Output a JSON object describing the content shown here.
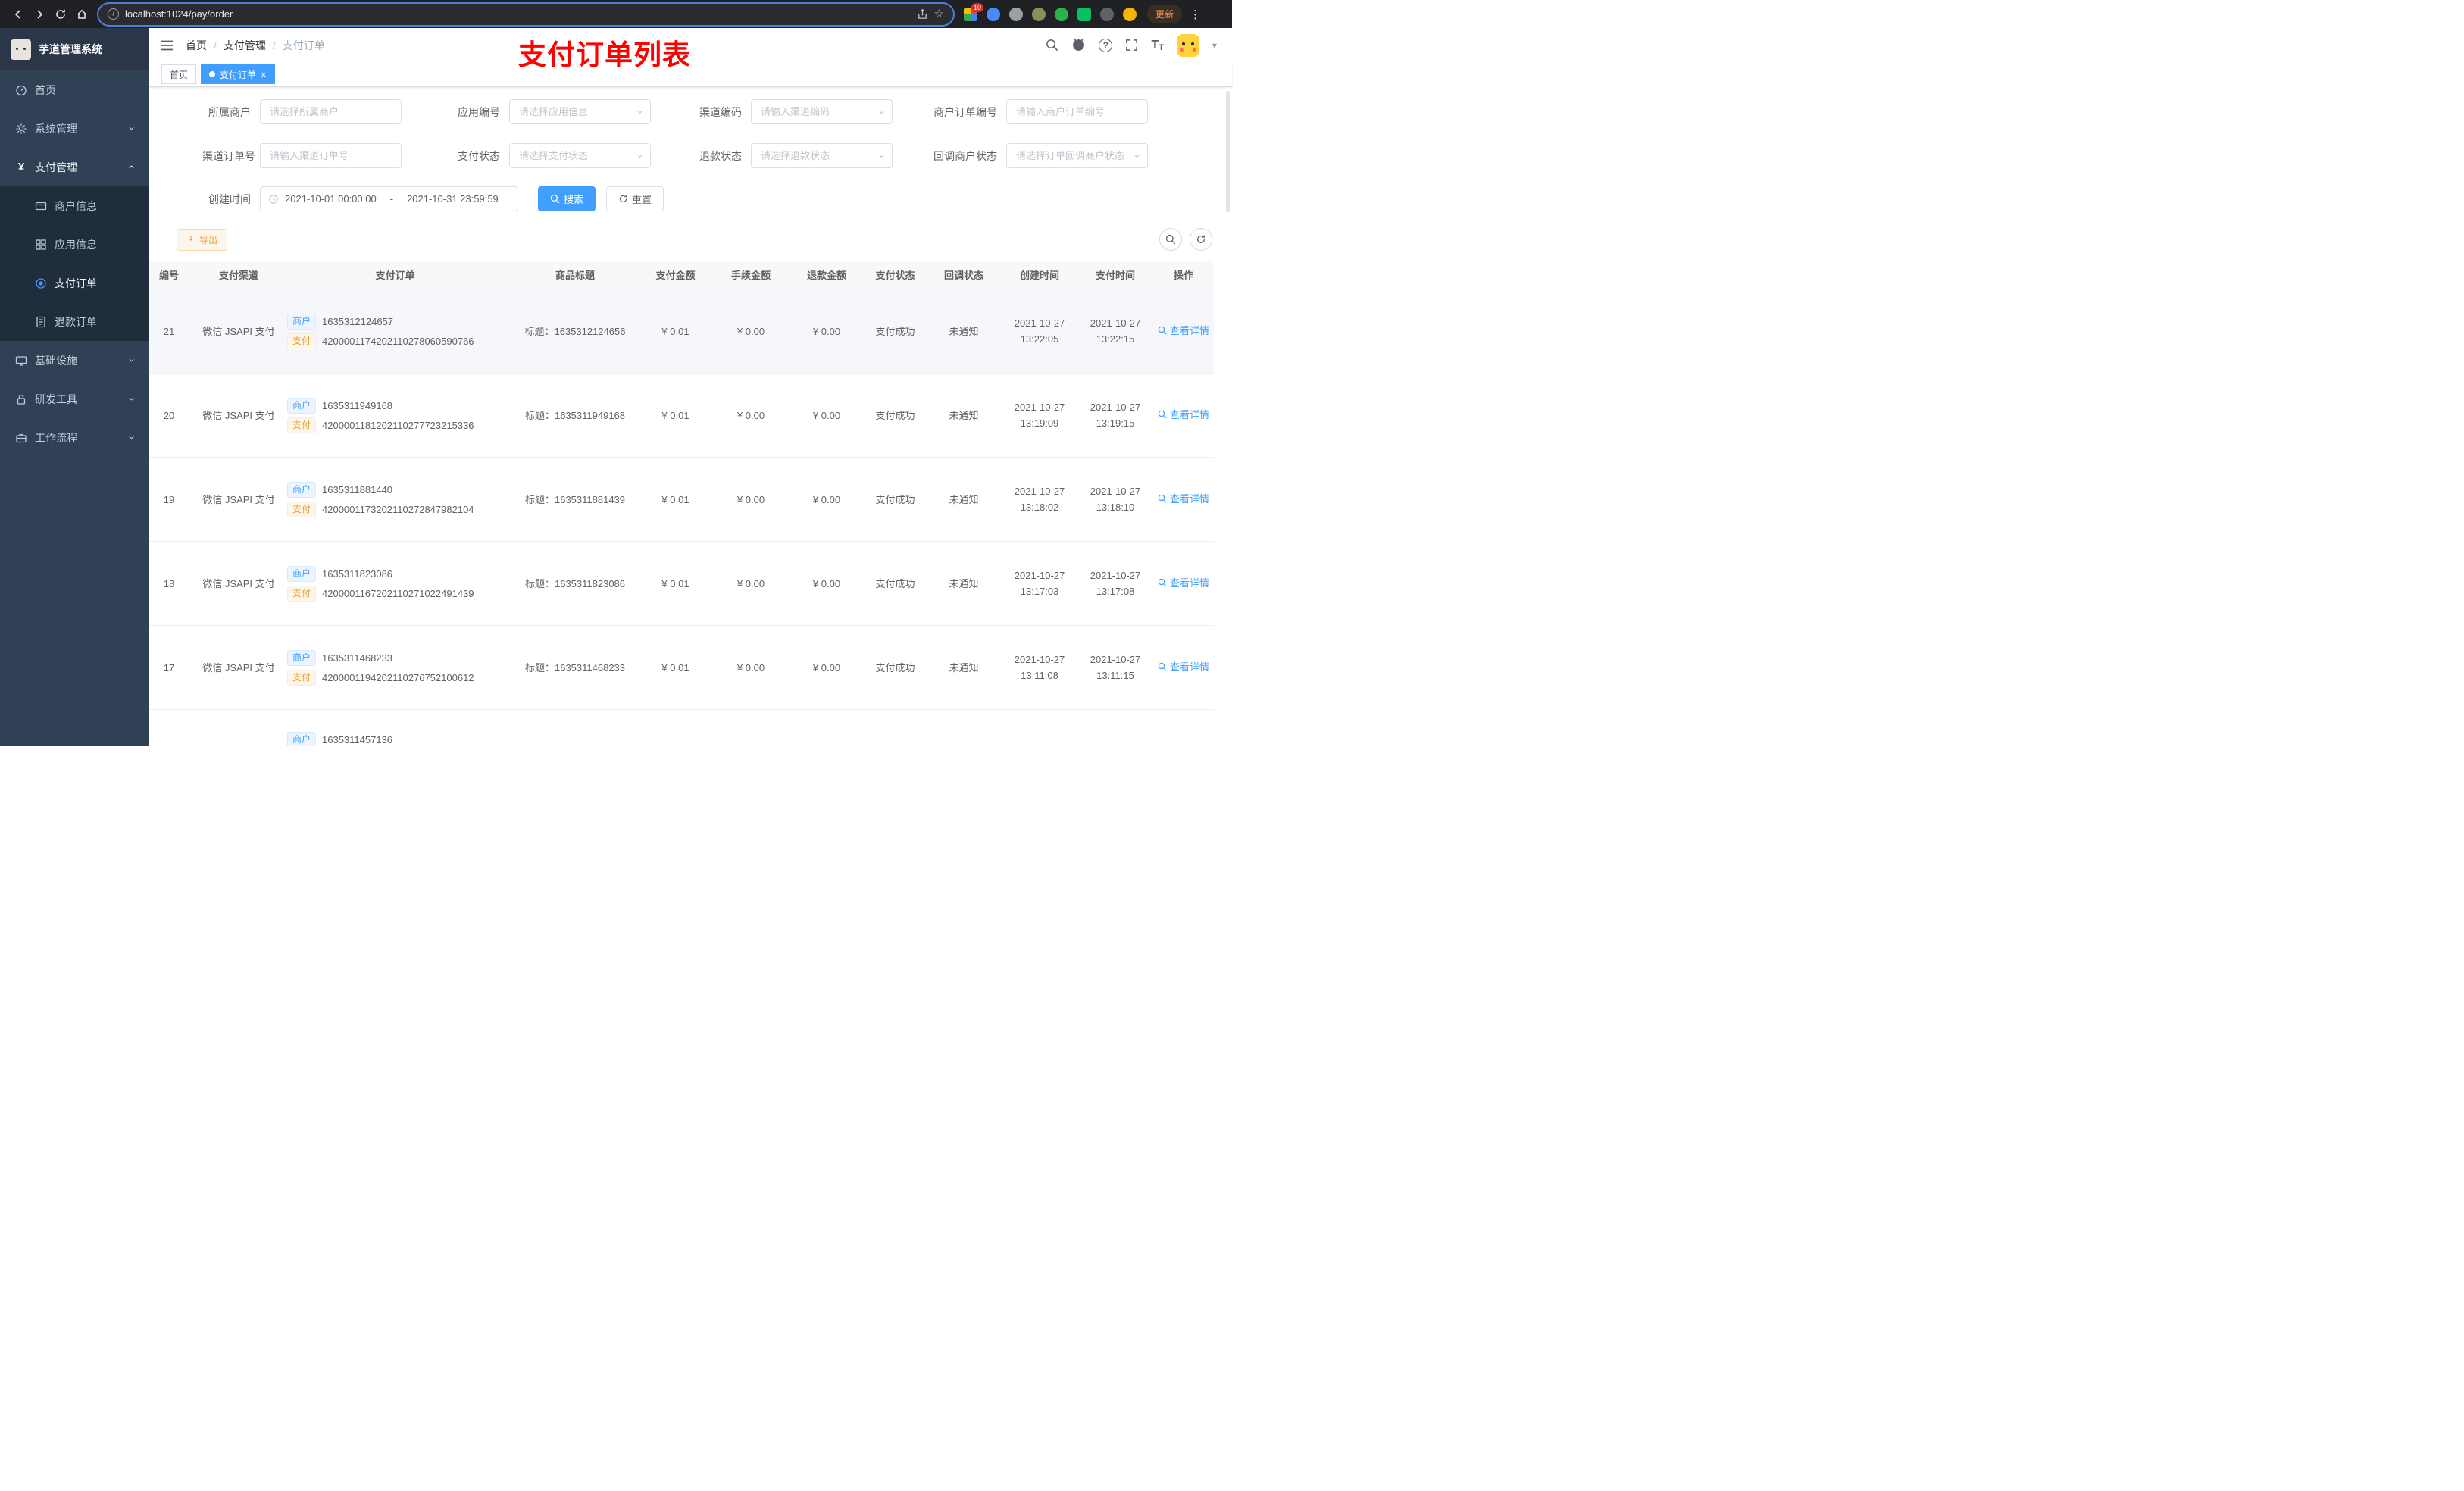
{
  "browser": {
    "url": "localhost:1024/pay/order",
    "update_label": "更新",
    "extension_badge": "10"
  },
  "app": {
    "title": "芋道管理系统"
  },
  "annotation": {
    "title": "支付订单列表"
  },
  "breadcrumb": {
    "items": [
      "首页",
      "支付管理",
      "支付订单"
    ],
    "separator": "/"
  },
  "tabs": [
    {
      "label": "首页"
    },
    {
      "label": "支付订单"
    }
  ],
  "sidebar": {
    "items": [
      {
        "label": "首页"
      },
      {
        "label": "系统管理"
      },
      {
        "label": "支付管理",
        "children": [
          {
            "label": "商户信息"
          },
          {
            "label": "应用信息"
          },
          {
            "label": "支付订单"
          },
          {
            "label": "退款订单"
          }
        ]
      },
      {
        "label": "基础设施"
      },
      {
        "label": "研发工具"
      },
      {
        "label": "工作流程"
      }
    ]
  },
  "filters": {
    "fields": [
      {
        "label": "所属商户",
        "placeholder": "请选择所属商户",
        "type": "input"
      },
      {
        "label": "应用编号",
        "placeholder": "请选择应用信息",
        "type": "select"
      },
      {
        "label": "渠道编码",
        "placeholder": "请输入渠道编码",
        "type": "select"
      },
      {
        "label": "商户订单编号",
        "placeholder": "请输入商户订单编号",
        "type": "input"
      },
      {
        "label": "渠道订单号",
        "placeholder": "请输入渠道订单号",
        "type": "input"
      },
      {
        "label": "支付状态",
        "placeholder": "请选择支付状态",
        "type": "select"
      },
      {
        "label": "退款状态",
        "placeholder": "请选择退款状态",
        "type": "select"
      },
      {
        "label": "回调商户状态",
        "placeholder": "请选择订单回调商户状态",
        "type": "select"
      }
    ],
    "date_field": {
      "label": "创建时间",
      "start": "2021-10-01 00:00:00",
      "separator": "-",
      "end": "2021-10-31 23:59:59"
    },
    "search_label": "搜索",
    "reset_label": "重置"
  },
  "toolbar": {
    "export_label": "导出"
  },
  "table": {
    "columns": [
      "编号",
      "支付渠道",
      "支付订单",
      "商品标题",
      "支付金额",
      "手续金额",
      "退款金额",
      "支付状态",
      "回调状态",
      "创建时间",
      "支付时间",
      "操作"
    ],
    "badges": {
      "merchant": "商户",
      "pay": "支付"
    },
    "action_label": "查看详情",
    "rows": [
      {
        "id": "21",
        "channel": "微信 JSAPI 支付",
        "merchant_no": "1635312124657",
        "pay_no": "4200001174202110278060590766",
        "title": "标题：1635312124656",
        "amount": "¥ 0.01",
        "fee": "¥ 0.00",
        "refund": "¥ 0.00",
        "status": "支付成功",
        "notify": "未通知",
        "create_date": "2021-10-27",
        "create_time": "13:22:05",
        "pay_date": "2021-10-27",
        "pay_time": "13:22:15",
        "highlighted": true
      },
      {
        "id": "20",
        "channel": "微信 JSAPI 支付",
        "merchant_no": "1635311949168",
        "pay_no": "4200001181202110277723215336",
        "title": "标题：1635311949168",
        "amount": "¥ 0.01",
        "fee": "¥ 0.00",
        "refund": "¥ 0.00",
        "status": "支付成功",
        "notify": "未通知",
        "create_date": "2021-10-27",
        "create_time": "13:19:09",
        "pay_date": "2021-10-27",
        "pay_time": "13:19:15"
      },
      {
        "id": "19",
        "channel": "微信 JSAPI 支付",
        "merchant_no": "1635311881440",
        "pay_no": "4200001173202110272847982104",
        "title": "标题：1635311881439",
        "amount": "¥ 0.01",
        "fee": "¥ 0.00",
        "refund": "¥ 0.00",
        "status": "支付成功",
        "notify": "未通知",
        "create_date": "2021-10-27",
        "create_time": "13:18:02",
        "pay_date": "2021-10-27",
        "pay_time": "13:18:10"
      },
      {
        "id": "18",
        "channel": "微信 JSAPI 支付",
        "merchant_no": "1635311823086",
        "pay_no": "4200001167202110271022491439",
        "title": "标题：1635311823086",
        "amount": "¥ 0.01",
        "fee": "¥ 0.00",
        "refund": "¥ 0.00",
        "status": "支付成功",
        "notify": "未通知",
        "create_date": "2021-10-27",
        "create_time": "13:17:03",
        "pay_date": "2021-10-27",
        "pay_time": "13:17:08"
      },
      {
        "id": "17",
        "channel": "微信 JSAPI 支付",
        "merchant_no": "1635311468233",
        "pay_no": "4200001194202110276752100612",
        "title": "标题：1635311468233",
        "amount": "¥ 0.01",
        "fee": "¥ 0.00",
        "refund": "¥ 0.00",
        "status": "支付成功",
        "notify": "未通知",
        "create_date": "2021-10-27",
        "create_time": "13:11:08",
        "pay_date": "2021-10-27",
        "pay_time": "13:11:15"
      }
    ],
    "partial_row": {
      "merchant_no": "1635311457136"
    }
  },
  "icons": {
    "star": "☆",
    "more_vertical": "⋮",
    "caret_down": "▾",
    "close": "×",
    "question": "?",
    "info": "i",
    "fontsize_big": "T",
    "fontsize_small": "T"
  }
}
